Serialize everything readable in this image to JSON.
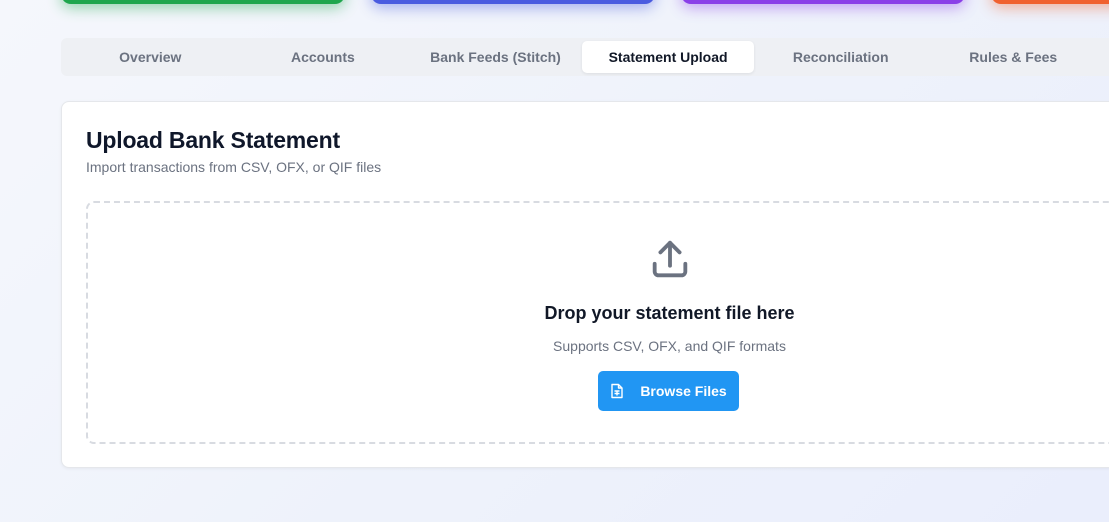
{
  "stat_cards": [
    {
      "name": "green",
      "color": "#1fa64d"
    },
    {
      "name": "blue",
      "color": "#4a5be0"
    },
    {
      "name": "purple",
      "color": "#8a3fe8"
    },
    {
      "name": "orange",
      "color": "#f0612f"
    }
  ],
  "tabs": [
    {
      "label": "Overview",
      "active": false
    },
    {
      "label": "Accounts",
      "active": false
    },
    {
      "label": "Bank Feeds (Stitch)",
      "active": false
    },
    {
      "label": "Statement Upload",
      "active": true
    },
    {
      "label": "Reconciliation",
      "active": false
    },
    {
      "label": "Rules & Fees",
      "active": false
    }
  ],
  "upload_card": {
    "title": "Upload Bank Statement",
    "subtitle": "Import transactions from CSV, OFX, or QIF files",
    "dropzone": {
      "icon": "upload-icon",
      "title": "Drop your statement file here",
      "subtitle": "Supports CSV, OFX, and QIF formats",
      "button_label": "Browse Files",
      "button_icon": "file-spreadsheet-icon"
    }
  },
  "colors": {
    "accent": "#2196f3",
    "active_tab_bg": "#ffffff",
    "tabbar_bg": "#eef0f4"
  }
}
